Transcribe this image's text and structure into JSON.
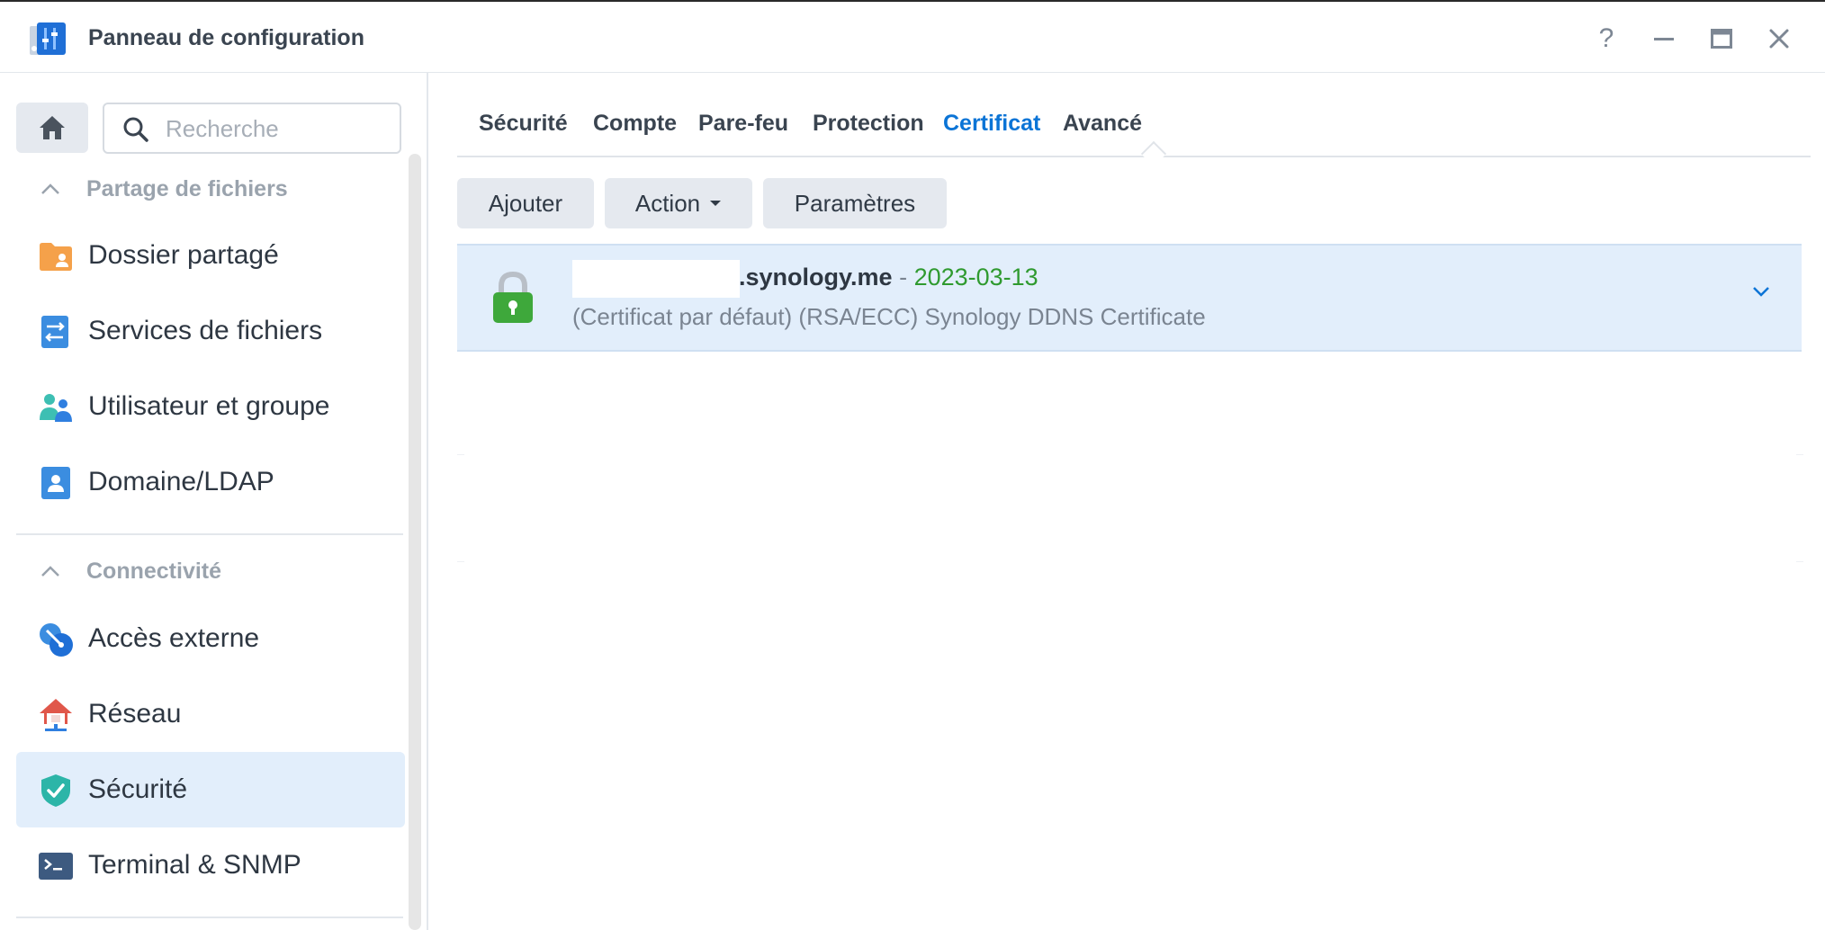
{
  "window": {
    "title": "Panneau de configuration"
  },
  "search": {
    "placeholder": "Recherche"
  },
  "sidebar": {
    "sections": [
      {
        "label": "Partage de fichiers"
      },
      {
        "label": "Connectivité"
      }
    ],
    "items": [
      {
        "label": "Dossier partagé",
        "icon": "shared-folder-icon"
      },
      {
        "label": "Services de fichiers",
        "icon": "file-services-icon"
      },
      {
        "label": "Utilisateur et groupe",
        "icon": "user-group-icon"
      },
      {
        "label": "Domaine/LDAP",
        "icon": "domain-ldap-icon"
      },
      {
        "label": "Accès externe",
        "icon": "external-access-icon"
      },
      {
        "label": "Réseau",
        "icon": "network-icon"
      },
      {
        "label": "Sécurité",
        "icon": "security-shield-icon",
        "active": true
      },
      {
        "label": "Terminal & SNMP",
        "icon": "terminal-icon"
      }
    ]
  },
  "tabs": [
    {
      "label": "Sécurité"
    },
    {
      "label": "Compte"
    },
    {
      "label": "Pare-feu"
    },
    {
      "label": "Protection"
    },
    {
      "label": "Certificat",
      "active": true
    },
    {
      "label": "Avancé"
    }
  ],
  "toolbar": {
    "add_label": "Ajouter",
    "action_label": "Action",
    "settings_label": "Paramètres"
  },
  "certificates": [
    {
      "domain": ".synology.me",
      "separator": "-",
      "expiry": "2023-03-13",
      "description": "(Certificat par défaut) (RSA/ECC) Synology DDNS Certificate"
    }
  ],
  "colors": {
    "accent": "#0b74d6",
    "active_bg": "#e2eefb",
    "date_green": "#2f9a2f",
    "lock_green": "#3ea83b"
  }
}
